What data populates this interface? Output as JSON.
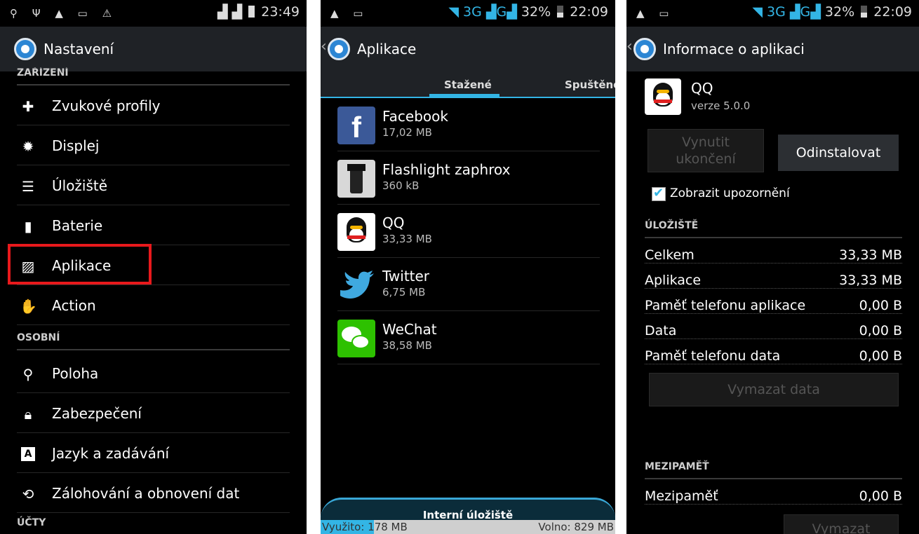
{
  "colors": {
    "accent": "#33b5e5",
    "highlight": "#e8191c",
    "background": "#000000"
  },
  "settings_screen": {
    "status_time": "23:49",
    "title": "Nastavení",
    "section_cut": "ZAŘÍZENÍ",
    "items_device": [
      {
        "label": "Zvukové profily",
        "icon": "sound-profile-icon"
      },
      {
        "label": "Displej",
        "icon": "display-icon"
      },
      {
        "label": "Úložiště",
        "icon": "storage-icon"
      },
      {
        "label": "Baterie",
        "icon": "battery-icon"
      },
      {
        "label": "Aplikace",
        "icon": "apps-icon"
      },
      {
        "label": "Action",
        "icon": "hand-icon"
      }
    ],
    "section_personal": "OSOBNÍ",
    "items_personal": [
      {
        "label": "Poloha",
        "icon": "location-icon"
      },
      {
        "label": "Zabezpečení",
        "icon": "lock-icon"
      },
      {
        "label": "Jazyk a zadávání",
        "icon": "keyboard-icon"
      },
      {
        "label": "Zálohování a obnovení dat",
        "icon": "backup-icon"
      }
    ],
    "section_accounts": "ÚČTY"
  },
  "apps_screen": {
    "status": {
      "network": "3G",
      "network2": "G",
      "battery": "32%",
      "time": "22:09"
    },
    "title": "Aplikace",
    "tabs": [
      "Stažené",
      "Spuštěné"
    ],
    "apps": [
      {
        "name": "Facebook",
        "size": "17,02 MB",
        "icon": "facebook-icon"
      },
      {
        "name": "Flashlight zaphrox",
        "size": "360 kB",
        "icon": "flashlight-icon"
      },
      {
        "name": "QQ",
        "size": "33,33 MB",
        "icon": "qq-icon"
      },
      {
        "name": "Twitter",
        "size": "6,75 MB",
        "icon": "twitter-icon"
      },
      {
        "name": "WeChat",
        "size": "38,58 MB",
        "icon": "wechat-icon"
      }
    ],
    "storage": {
      "title": "Interní úložiště",
      "used": "Využito: 178 MB",
      "free": "Volno: 829 MB",
      "used_fraction": 0.18
    }
  },
  "app_info_screen": {
    "status": {
      "network": "3G",
      "network2": "G",
      "battery": "32%",
      "time": "22:09"
    },
    "title": "Informace o aplikaci",
    "app_name": "QQ",
    "version": "verze 5.0.0",
    "force_stop": "Vynutit ukončení",
    "uninstall": "Odinstalovat",
    "show_notifications": "Zobrazit upozornění",
    "storage_header": "ÚLOŽIŠTĚ",
    "storage_rows": [
      {
        "label": "Celkem",
        "value": "33,33 MB"
      },
      {
        "label": "Aplikace",
        "value": "33,33 MB"
      },
      {
        "label": "Paměť telefonu aplikace",
        "value": "0,00 B"
      },
      {
        "label": "Data",
        "value": "0,00 B"
      },
      {
        "label": "Paměť telefonu data",
        "value": "0,00 B"
      }
    ],
    "clear_data": "Vymazat data",
    "cache_header": "MEZIPAMĚŤ",
    "cache_row": {
      "label": "Mezipaměť",
      "value": "0,00 B"
    },
    "clear_cache": "Vymazat"
  }
}
